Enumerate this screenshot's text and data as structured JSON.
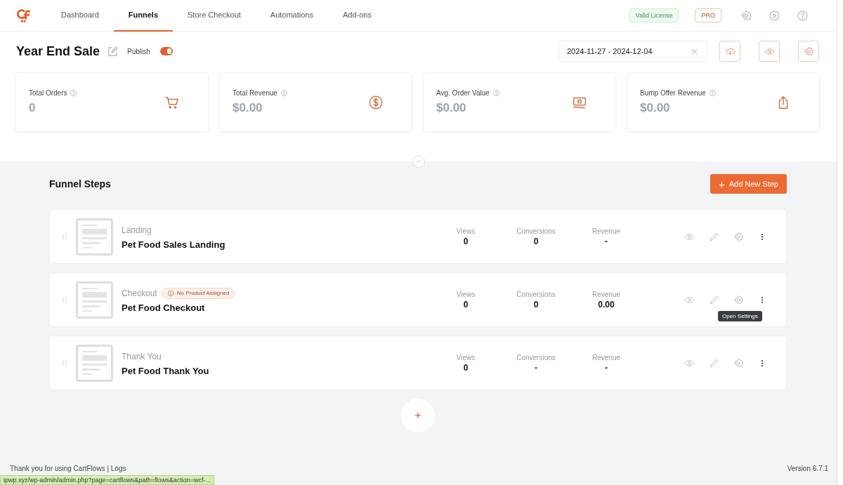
{
  "nav": {
    "tabs": [
      {
        "label": "Dashboard",
        "selected": false
      },
      {
        "label": "Funnels",
        "selected": true
      },
      {
        "label": "Store Checkout",
        "selected": false
      },
      {
        "label": "Automations",
        "selected": false
      },
      {
        "label": "Add-ons",
        "selected": false
      }
    ],
    "license": "Valid License",
    "plan": "PRO"
  },
  "funnel": {
    "title": "Year End Sale",
    "publish_label": "Publish",
    "published": true,
    "date_range": "2024-11-27 - 2024-12-04"
  },
  "stats": [
    {
      "label": "Total Orders",
      "value": "0",
      "kind": "cart"
    },
    {
      "label": "Total Revenue",
      "value": "$0.00",
      "kind": "dollar"
    },
    {
      "label": "Avg. Order Value",
      "value": "$0.00",
      "kind": "cash"
    },
    {
      "label": "Bump Offer Revenue",
      "value": "$0.00",
      "kind": "share"
    }
  ],
  "steps_section": {
    "title": "Funnel Steps",
    "add_button": "Add New Step",
    "add_icon": "+"
  },
  "steps": [
    {
      "type": "Landing",
      "name": "Pet Food Sales Landing",
      "views_label": "Views",
      "views": "0",
      "conversions_label": "Conversions",
      "conversions": "0",
      "revenue_label": "Revenue",
      "revenue": "-"
    },
    {
      "type": "Checkout",
      "name": "Pet Food Checkout",
      "badge": "No Product Assigned",
      "views_label": "Views",
      "views": "0",
      "conversions_label": "Conversions",
      "conversions": "0",
      "revenue_label": "Revenue",
      "revenue": "0.00",
      "tooltip": "Open Settings"
    },
    {
      "type": "Thank You",
      "name": "Pet Food Thank You",
      "views_label": "Views",
      "views": "0",
      "conversions_label": "Conversions",
      "conversions": "-",
      "revenue_label": "Revenue",
      "revenue": "-"
    }
  ],
  "add_step_icon": "+",
  "footer": {
    "text": "Thank you for using CartFlows | Logs",
    "version": "Version 6.7.1"
  },
  "status_bar": {
    "url": "ipwp.xyz/wp-admin/admin.php?page=cartflows&path=flows&action=wcf-..."
  }
}
